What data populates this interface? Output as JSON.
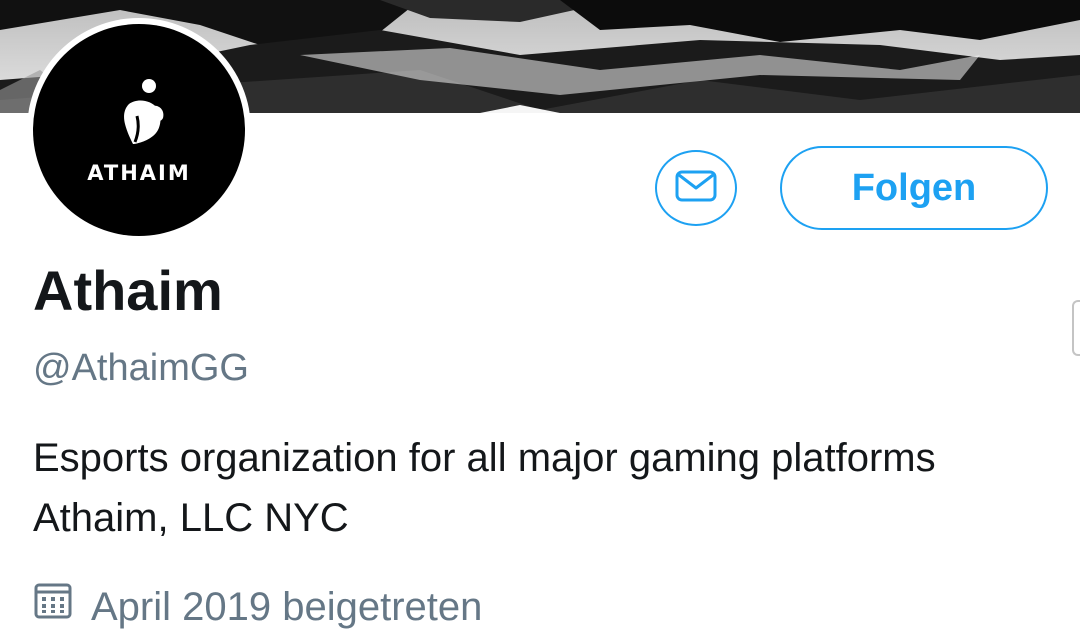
{
  "profile": {
    "display_name": "Athaim",
    "handle": "@AthaimGG",
    "bio": "Esports organization for all major gaming platforms Athaim, LLC NYC",
    "joined": "April 2019 beigetreten",
    "avatar_logo_text": "ATHAIM"
  },
  "actions": {
    "follow_label": "Folgen",
    "message_icon": "envelope-icon"
  },
  "icons": {
    "joined": "calendar-icon"
  },
  "colors": {
    "accent": "#1da1f2",
    "secondary_text": "#657786",
    "primary_text": "#14171a"
  }
}
